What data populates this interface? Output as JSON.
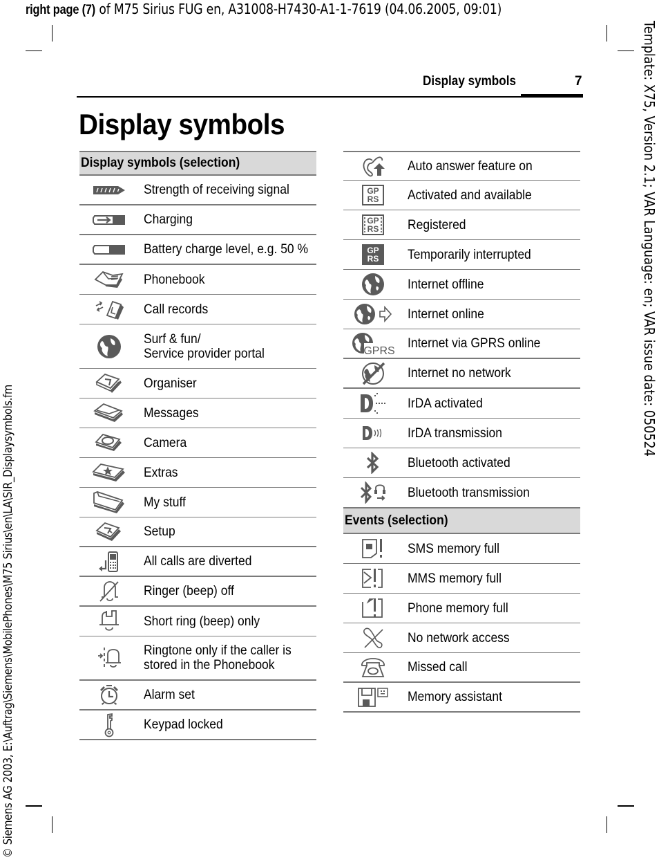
{
  "job_line": {
    "bold_part": "right page (7)",
    "rest": " of M75 Sirius FUG en, A31008-H7430-A1-1-7619 (04.06.2005, 09:01)"
  },
  "side_left": "© Siemens AG 2003, E:\\Auftrag\\Siemens\\MobilePhones\\M75 Sirius\\en\\LA\\SIR_Displaysymbols.fm",
  "side_right": "Template: X75, Version 2.1; VAR Language: en; VAR issue date: 050524",
  "running_head": {
    "title": "Display symbols",
    "page_number": "7"
  },
  "page_title": "Display symbols",
  "left_table": {
    "header": "Display symbols (selection)",
    "rows": [
      {
        "icon": "signal-strength-icon",
        "label": "Strength of receiving signal"
      },
      {
        "icon": "charging-icon",
        "label": "Charging"
      },
      {
        "icon": "battery-level-icon",
        "label": "Battery charge level, e.g. 50 %"
      },
      {
        "icon": "phonebook-icon",
        "label": "Phonebook"
      },
      {
        "icon": "call-records-icon",
        "label": "Call records"
      },
      {
        "icon": "globe-icon",
        "label_line1": "Surf & fun/",
        "label_line2": "Service provider portal"
      },
      {
        "icon": "organiser-icon",
        "label": "Organiser"
      },
      {
        "icon": "messages-icon",
        "label": "Messages"
      },
      {
        "icon": "camera-icon",
        "label": "Camera"
      },
      {
        "icon": "extras-icon",
        "label": "Extras"
      },
      {
        "icon": "my-stuff-icon",
        "label": "My stuff"
      },
      {
        "icon": "setup-icon",
        "label": "Setup"
      },
      {
        "icon": "call-divert-icon",
        "label": "All calls are diverted"
      },
      {
        "icon": "ringer-off-icon",
        "label": "Ringer (beep) off"
      },
      {
        "icon": "short-ring-icon",
        "label": "Short ring (beep) only"
      },
      {
        "icon": "ringtone-phonebook-icon",
        "label_line1": "Ringtone only if the caller is",
        "label_line2": "stored in the Phonebook"
      },
      {
        "icon": "alarm-clock-icon",
        "label": "Alarm set"
      },
      {
        "icon": "key-icon",
        "label": "Keypad locked"
      }
    ]
  },
  "right_table": {
    "rows": [
      {
        "icon": "auto-answer-icon",
        "label": "Auto answer feature on"
      },
      {
        "icon": "gprs-available-icon",
        "label": "Activated and available",
        "icon_text1": "GP",
        "icon_text2": "RS"
      },
      {
        "icon": "gprs-registered-icon",
        "label": "Registered",
        "icon_text1": "GP",
        "icon_text2": "RS"
      },
      {
        "icon": "gprs-interrupted-icon",
        "label": "Temporarily interrupted",
        "icon_text1": "GP",
        "icon_text2": "RS"
      },
      {
        "icon": "internet-offline-icon",
        "label": "Internet offline"
      },
      {
        "icon": "internet-online-icon",
        "label": "Internet online"
      },
      {
        "icon": "internet-gprs-icon",
        "label": "Internet via GPRS online",
        "icon_text": "GPRS"
      },
      {
        "icon": "internet-no-network-icon",
        "label": "Internet no network"
      },
      {
        "icon": "irda-activated-icon",
        "label": "IrDA activated"
      },
      {
        "icon": "irda-transmission-icon",
        "label": "IrDA transmission"
      },
      {
        "icon": "bluetooth-icon",
        "label": "Bluetooth activated"
      },
      {
        "icon": "bluetooth-transmission-icon",
        "label": "Bluetooth transmission"
      }
    ],
    "events_header": "Events (selection)",
    "events": [
      {
        "icon": "sms-memory-full-icon",
        "label": "SMS memory full"
      },
      {
        "icon": "mms-memory-full-icon",
        "label": "MMS memory full"
      },
      {
        "icon": "phone-memory-full-icon",
        "label": "Phone memory full"
      },
      {
        "icon": "no-network-icon",
        "label": "No network access"
      },
      {
        "icon": "missed-call-icon",
        "label": "Missed call"
      },
      {
        "icon": "memory-assistant-icon",
        "label": "Memory assistant"
      }
    ]
  }
}
